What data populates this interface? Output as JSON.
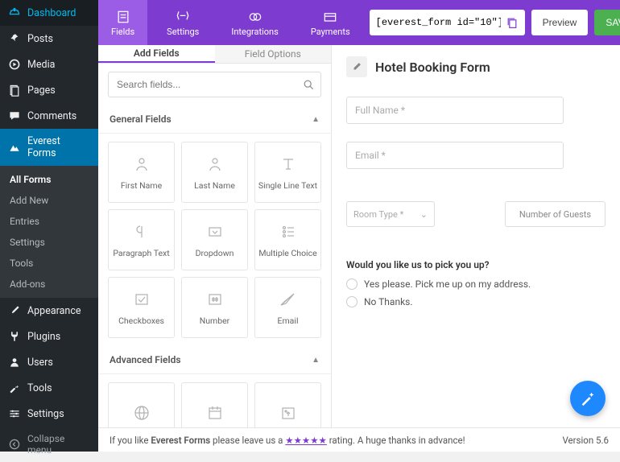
{
  "sidebar": {
    "items": [
      {
        "label": "Dashboard",
        "icon": "dashboard"
      },
      {
        "label": "Posts",
        "icon": "pin"
      },
      {
        "label": "Media",
        "icon": "media"
      },
      {
        "label": "Pages",
        "icon": "page"
      },
      {
        "label": "Comments",
        "icon": "comment"
      },
      {
        "label": "Everest Forms",
        "icon": "ef",
        "active": true
      },
      {
        "label": "Appearance",
        "icon": "brush"
      },
      {
        "label": "Plugins",
        "icon": "plug"
      },
      {
        "label": "Users",
        "icon": "user"
      },
      {
        "label": "Tools",
        "icon": "wrench"
      },
      {
        "label": "Settings",
        "icon": "sliders"
      }
    ],
    "submenu": [
      {
        "label": "All Forms",
        "current": true
      },
      {
        "label": "Add New"
      },
      {
        "label": "Entries"
      },
      {
        "label": "Settings"
      },
      {
        "label": "Tools"
      },
      {
        "label": "Add-ons"
      }
    ],
    "collapse": "Collapse menu"
  },
  "topbar": {
    "tabs": [
      {
        "label": "Fields",
        "active": true
      },
      {
        "label": "Settings"
      },
      {
        "label": "Integrations"
      },
      {
        "label": "Payments"
      }
    ],
    "shortcode": "[everest_form id=\"10\"]",
    "preview": "Preview",
    "save": "SAVE"
  },
  "panel": {
    "tabs": {
      "add": "Add Fields",
      "options": "Field Options"
    },
    "search_placeholder": "Search fields...",
    "general_head": "General Fields",
    "advanced_head": "Advanced Fields",
    "general": [
      {
        "label": "First Name",
        "icon": "person"
      },
      {
        "label": "Last Name",
        "icon": "person"
      },
      {
        "label": "Single Line Text",
        "icon": "text"
      },
      {
        "label": "Paragraph Text",
        "icon": "para"
      },
      {
        "label": "Dropdown",
        "icon": "drop"
      },
      {
        "label": "Multiple Choice",
        "icon": "multi"
      },
      {
        "label": "Checkboxes",
        "icon": "check"
      },
      {
        "label": "Number",
        "icon": "hash"
      },
      {
        "label": "Email",
        "icon": "mail"
      }
    ],
    "advanced": [
      {
        "label": "",
        "icon": "globe"
      },
      {
        "label": "",
        "icon": "date"
      },
      {
        "label": "",
        "icon": "upload"
      }
    ]
  },
  "preview": {
    "title": "Hotel Booking Form",
    "fullname": "Full Name *",
    "email": "Email *",
    "roomtype": "Room Type *",
    "guests": "Number of Guests",
    "question": "Would you like us to pick you up?",
    "opt1": "Yes please. Pick me up on my address.",
    "opt2": "No Thanks."
  },
  "footer": {
    "pre": "If you like ",
    "brand": "Everest Forms",
    "mid": " please leave us a ",
    "stars": "★★★★★",
    "post": " rating. A huge thanks in advance!",
    "version": "Version 5.6"
  }
}
